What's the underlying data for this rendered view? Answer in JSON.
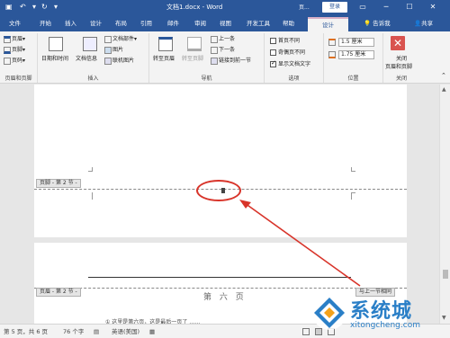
{
  "titlebar": {
    "title": "文档1.docx  -  Word",
    "context_label": "页...",
    "login_label": "登录",
    "restore_icon": "ribbon-display-icon",
    "minimize_label": "─",
    "maximize_label": "☐",
    "close_label": "✕"
  },
  "tabs": [
    "文件",
    "开始",
    "插入",
    "设计",
    "布局",
    "引用",
    "邮件",
    "审阅",
    "视图",
    "开发工具",
    "帮助",
    "设计"
  ],
  "active_tab_index": 11,
  "tell_me": "告诉我",
  "share": "共享",
  "ribbon": {
    "group_header_footer": {
      "items": [
        "页眉",
        "页脚",
        "页码"
      ],
      "label": "页眉和页脚"
    },
    "group_insert": {
      "date_time": "日期和时间",
      "doc_info": "文档信息",
      "doc_parts": "文档部件",
      "picture": "图片",
      "online_picture": "联机图片",
      "label": "插入"
    },
    "group_nav": {
      "goto_header": "转至页眉",
      "goto_footer": "转至页脚",
      "prev": "上一条",
      "next": "下一条",
      "link_prev": "链接到前一节",
      "label": "导航"
    },
    "group_options": {
      "diff_first": "首页不同",
      "diff_odd_even": "奇偶页不同",
      "show_doc_text": "显示文档文字",
      "diff_first_checked": false,
      "diff_odd_even_checked": false,
      "show_doc_text_checked": true,
      "label": "选项"
    },
    "group_position": {
      "header_pos": "1.5 厘米",
      "footer_pos": "1.75 厘米",
      "label": "位置"
    },
    "group_close": {
      "close_btn": "关闭",
      "close_btn2": "页眉和页脚",
      "label": "关闭"
    }
  },
  "document": {
    "footer_tag": "页脚 - 第 2 节 -",
    "header_tag": "页眉 - 第 2 节 -",
    "prev_tag": "与上一节相同",
    "page_title": "第 六 页",
    "body_text": "①  这里是第六页，这是最后一页了 ……"
  },
  "statusbar": {
    "page": "第 5 页，共 6 页",
    "words": "76 个字",
    "language": "英语(美国)"
  },
  "watermark": {
    "cn": "系统城",
    "en": "xitongcheng.com"
  },
  "colors": {
    "word_blue": "#2b579a",
    "annotation_red": "#d8342a",
    "watermark_blue": "#2a7fc7"
  }
}
